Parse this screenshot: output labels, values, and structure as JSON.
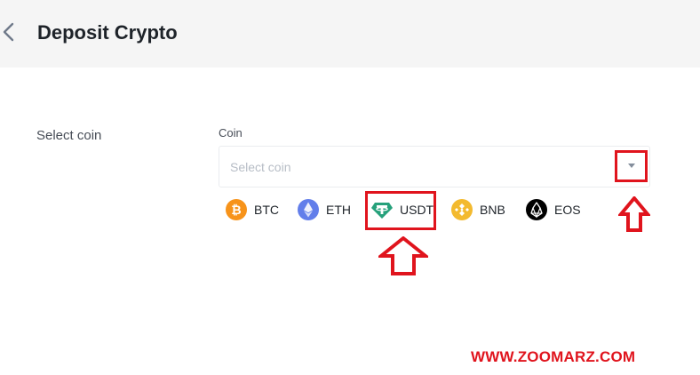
{
  "header": {
    "title": "Deposit Crypto"
  },
  "form": {
    "section_label": "Select coin",
    "field_label": "Coin",
    "placeholder": "Select coin"
  },
  "coins": [
    {
      "symbol": "BTC",
      "icon": "btc-icon",
      "color": "#f7931a"
    },
    {
      "symbol": "ETH",
      "icon": "eth-icon",
      "color": "#627eea"
    },
    {
      "symbol": "USDT",
      "icon": "usdt-icon",
      "color": "#26a17b"
    },
    {
      "symbol": "BNB",
      "icon": "bnb-icon",
      "color": "#f3ba2f"
    },
    {
      "symbol": "EOS",
      "icon": "eos-icon",
      "color": "#000000"
    }
  ],
  "annotations": {
    "highlight_color": "#e0141d"
  },
  "watermark": "WWW.ZOOMARZ.COM"
}
